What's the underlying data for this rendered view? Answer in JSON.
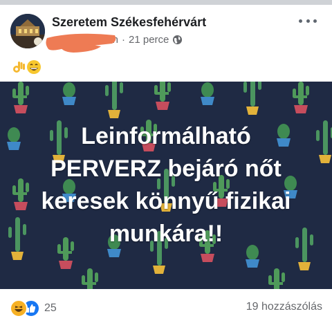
{
  "post": {
    "group_name": "Szeretem Székesfehérvárt",
    "author_visible_fragment": "n",
    "timestamp": "21 perce",
    "separator": "·",
    "privacy_icon": "globe-icon",
    "emojis": [
      "ok-hand-emoji",
      "grinning-face-emoji"
    ]
  },
  "banner": {
    "lines": [
      "Leinformálható",
      "PERVERZ bejáró nőt",
      "keresek könnyű fizikai",
      "munkára!!"
    ],
    "background_color": "#1f2a44",
    "pattern": "cactus-pattern"
  },
  "footer": {
    "reaction_icons": [
      "haha-reaction-icon",
      "like-reaction-icon"
    ],
    "reaction_count": "25",
    "comment_count": "19 hozzászólás"
  },
  "colors": {
    "redaction": "#ee7b54",
    "meta_text": "#65676b",
    "like_blue": "#1877f2"
  }
}
